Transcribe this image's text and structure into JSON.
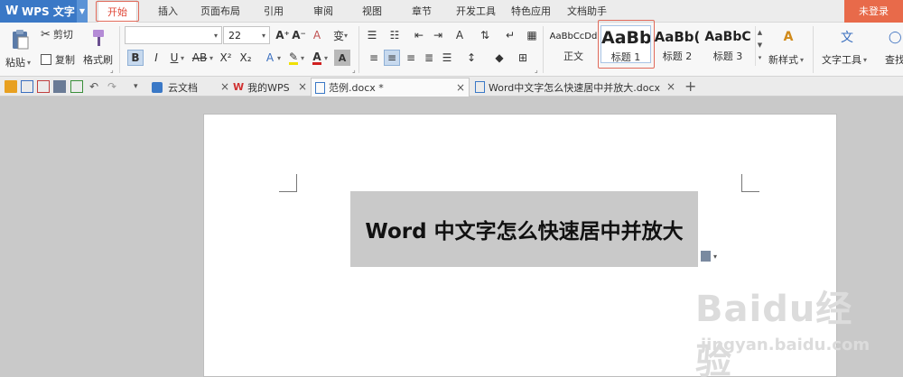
{
  "app": {
    "title": "WPS 文字"
  },
  "menu": {
    "tabs": [
      "开始",
      "插入",
      "页面布局",
      "引用",
      "审阅",
      "视图",
      "章节",
      "开发工具",
      "特色应用",
      "文档助手"
    ],
    "active_tab": "开始",
    "login_label": "未登录"
  },
  "ribbon": {
    "clipboard": {
      "paste": "粘贴",
      "cut": "剪切",
      "copy": "复制",
      "format_painter": "格式刷"
    },
    "font": {
      "font_name": "",
      "font_size": "22",
      "bold": "B",
      "italic": "I",
      "underline": "U",
      "strikethrough": "AB",
      "superscript": "X²",
      "subscript": "X₂",
      "grow": "A⁺",
      "shrink": "A⁻",
      "clear": "A",
      "phonetic": "变"
    },
    "styles": {
      "items": [
        {
          "sample": "AaBbCcDd",
          "name": "正文"
        },
        {
          "sample": "AaBb",
          "name": "标题 1"
        },
        {
          "sample": "AaBb(",
          "name": "标题 2"
        },
        {
          "sample": "AaBbC",
          "name": "标题 3"
        }
      ],
      "new_style": "新样式",
      "text_tools": "文字工具",
      "find": "查找"
    }
  },
  "tabs": [
    {
      "label": "云文档",
      "active": false
    },
    {
      "label": "我的WPS",
      "active": false
    },
    {
      "label": "范例.docx *",
      "active": true
    },
    {
      "label": "Word中文字怎么快速居中并放大.docx",
      "active": false
    }
  ],
  "document": {
    "heading_latin": "Word",
    "heading_cjk": " 中文字怎么快速居中并放大"
  },
  "watermark": {
    "brand": "Baidu经验",
    "url": "jingyan.baidu.com"
  },
  "colors": {
    "accent": "#3a78c6",
    "active_tab": "#e04838",
    "login": "#e86a4a",
    "selection": "#c9c9c9",
    "highlight_box": "#e06a5a"
  }
}
